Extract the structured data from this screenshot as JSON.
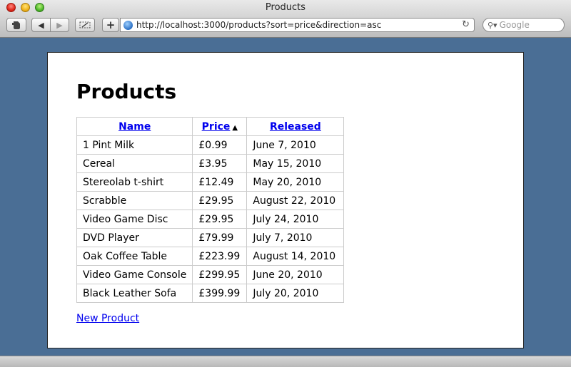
{
  "window": {
    "title": "Products"
  },
  "toolbar": {
    "back_icon": "◀",
    "forward_icon": "▶",
    "add_icon": "+",
    "reload_icon": "↻"
  },
  "address_bar": {
    "url": "http://localhost:3000/products?sort=price&direction=asc"
  },
  "search": {
    "placeholder": "Google"
  },
  "page": {
    "heading": "Products",
    "columns": {
      "name": "Name",
      "price": "Price",
      "released": "Released"
    },
    "sort_indicator": "▲",
    "rows": [
      {
        "name": "1 Pint Milk",
        "price": "£0.99",
        "released": "June 7, 2010"
      },
      {
        "name": "Cereal",
        "price": "£3.95",
        "released": "May 15, 2010"
      },
      {
        "name": "Stereolab t-shirt",
        "price": "£12.49",
        "released": "May 20, 2010"
      },
      {
        "name": "Scrabble",
        "price": "£29.95",
        "released": "August 22, 2010"
      },
      {
        "name": "Video Game Disc",
        "price": "£29.95",
        "released": "July 24, 2010"
      },
      {
        "name": "DVD Player",
        "price": "£79.99",
        "released": "July 7, 2010"
      },
      {
        "name": "Oak Coffee Table",
        "price": "£223.99",
        "released": "August 14, 2010"
      },
      {
        "name": "Video Game Console",
        "price": "£299.95",
        "released": "June 20, 2010"
      },
      {
        "name": "Black Leather Sofa",
        "price": "£399.99",
        "released": "July 20, 2010"
      }
    ],
    "new_product_link": "New Product"
  }
}
